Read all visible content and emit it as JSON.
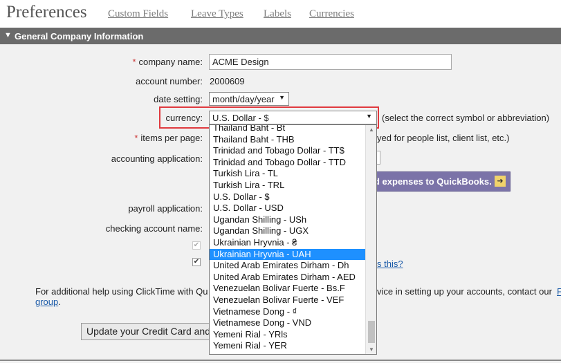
{
  "header": {
    "title": "Preferences",
    "links": [
      "Custom Fields",
      "Leave Types",
      "Labels",
      "Currencies"
    ]
  },
  "section": {
    "title": "General Company Information"
  },
  "form": {
    "company_name": {
      "required_mark": "*",
      "label": "company name:",
      "value": "ACME Design"
    },
    "account_number": {
      "label": "account number:",
      "value": "2000609"
    },
    "date_setting": {
      "label": "date setting:",
      "value": "month/day/year"
    },
    "currency": {
      "label": "currency:",
      "value": "U.S. Dollar - $",
      "hint": "(select the correct symbol or abbreviation)"
    },
    "items_per_page": {
      "required_mark": "*",
      "label": "items per page:",
      "hint_fragment": "yed for people list, client list, etc.)"
    },
    "accounting_application": {
      "label": "accounting application:"
    },
    "payroll_application": {
      "label": "payroll application:"
    },
    "checking_account_name": {
      "label": "checking account name:"
    }
  },
  "quickbooks_button": {
    "label": "d expenses to QuickBooks.",
    "arrow": "➜"
  },
  "what_is_this": "s this?",
  "help_text": {
    "left": "For additional help using ClickTime with Qu",
    "right": "vice in setting up your accounts, contact our",
    "right_link": "F",
    "second_line_link": "group",
    "second_line_end": "."
  },
  "update_button": {
    "label": "Update your Credit Card and F"
  },
  "currency_dropdown": {
    "selected_index": 11,
    "options": [
      "Thailand Baht - Bt",
      "Thailand Baht - THB",
      "Trinidad and Tobago Dollar - TT$",
      "Trinidad and Tobago Dollar - TTD",
      "Turkish Lira - TL",
      "Turkish Lira - TRL",
      "U.S. Dollar - $",
      "U.S. Dollar - USD",
      "Ugandan Shilling - USh",
      "Ugandan Shilling - UGX",
      "Ukrainian Hryvnia - ₴",
      "Ukrainian Hryvnia - UAH",
      "United Arab Emirates Dirham - Dh",
      "United Arab Emirates Dirham - AED",
      "Venezuelan Bolivar Fuerte - Bs.F",
      "Venezuelan Bolivar Fuerte - VEF",
      "Vietnamese Dong - ₫",
      "Vietnamese Dong - VND",
      "Yemeni Rial - YRls",
      "Yemeni Rial - YER"
    ]
  },
  "icons": {
    "section_toggle": "triangle-down",
    "dropdown": "caret-down",
    "check": "✔"
  },
  "colors": {
    "highlight": "#e0393e",
    "selected_option": "#1e90ff",
    "section_bar": "#6b6b6b"
  }
}
